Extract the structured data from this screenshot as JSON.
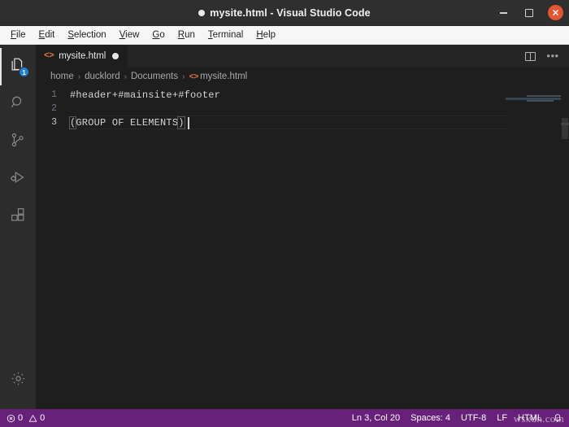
{
  "window": {
    "title": "mysite.html - Visual Studio Code",
    "dirty_indicator": "unsaved-dot",
    "controls": {
      "minimize": "minimize-button",
      "maximize": "maximize-button",
      "close": "close-button"
    }
  },
  "menubar": {
    "items": [
      {
        "label": "File",
        "mnemonic": "F"
      },
      {
        "label": "Edit",
        "mnemonic": "E"
      },
      {
        "label": "Selection",
        "mnemonic": "S"
      },
      {
        "label": "View",
        "mnemonic": "V"
      },
      {
        "label": "Go",
        "mnemonic": "G"
      },
      {
        "label": "Run",
        "mnemonic": "R"
      },
      {
        "label": "Terminal",
        "mnemonic": "T"
      },
      {
        "label": "Help",
        "mnemonic": "H"
      }
    ]
  },
  "activitybar": {
    "items": [
      {
        "name": "explorer",
        "icon": "files-icon",
        "badge": "1",
        "active": true
      },
      {
        "name": "search",
        "icon": "search-icon",
        "badge": "",
        "active": false
      },
      {
        "name": "source-control",
        "icon": "source-control-icon",
        "badge": "",
        "active": false
      },
      {
        "name": "run-debug",
        "icon": "run-debug-icon",
        "badge": "",
        "active": false
      },
      {
        "name": "extensions",
        "icon": "extensions-icon",
        "badge": "",
        "active": false
      }
    ],
    "bottom": [
      {
        "name": "manage-settings",
        "icon": "gear-icon"
      }
    ]
  },
  "tabs": {
    "active_index": 0,
    "items": [
      {
        "label": "mysite.html",
        "icon": "html-file-icon",
        "icon_glyph": "<>",
        "dirty": true
      }
    ],
    "actions": [
      {
        "name": "split-editor",
        "icon": "split-editor-icon"
      },
      {
        "name": "more-actions",
        "icon": "ellipsis-icon",
        "glyph": "•••"
      }
    ]
  },
  "breadcrumb": {
    "separator": "›",
    "items": [
      {
        "label": "home",
        "icon": ""
      },
      {
        "label": "ducklord",
        "icon": ""
      },
      {
        "label": "Documents",
        "icon": ""
      },
      {
        "label": "mysite.html",
        "icon": "<>"
      }
    ]
  },
  "editor": {
    "language": "HTML",
    "lines": [
      {
        "number": "1",
        "text": "#header+#mainsite+#footer",
        "active": false
      },
      {
        "number": "2",
        "text": "",
        "active": false
      },
      {
        "number": "3",
        "text": "(GROUP OF ELEMENTS)",
        "active": true,
        "bracket_open": "(",
        "bracket_inner": "GROUP OF ELEMENTS",
        "bracket_close": ")"
      }
    ]
  },
  "statusbar": {
    "left": [
      {
        "name": "errors",
        "icon": "error-circle-icon",
        "value": "0"
      },
      {
        "name": "warnings",
        "icon": "warning-triangle-icon",
        "value": "0"
      }
    ],
    "right": [
      {
        "name": "cursor-position",
        "label": "Ln 3, Col 20"
      },
      {
        "name": "indentation",
        "label": "Spaces: 4"
      },
      {
        "name": "encoding",
        "label": "UTF-8"
      },
      {
        "name": "eol",
        "label": "LF"
      },
      {
        "name": "language-mode",
        "label": "HTML"
      },
      {
        "name": "notifications",
        "label": "",
        "icon": "bell-icon"
      }
    ],
    "background_color": "#68217a"
  },
  "watermark": {
    "text": "wsxdn.com"
  }
}
